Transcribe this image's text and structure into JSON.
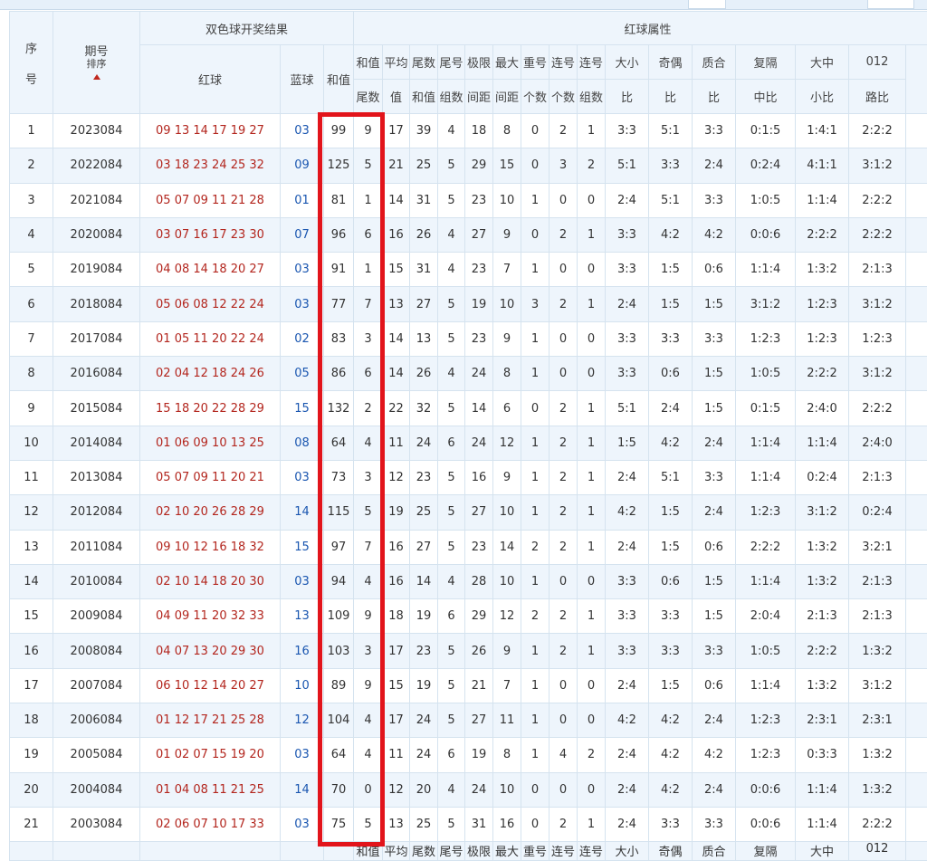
{
  "headers": {
    "seq": "序号",
    "seq_line1": "序",
    "seq_line2": "号",
    "issue": "期号",
    "sort_label": "排序",
    "group_result": "双色球开奖结果",
    "group_attr": "红球属性",
    "red": "红球",
    "blue": "蓝球",
    "sum": "和值",
    "sum_tail_1": "和值",
    "sum_tail_2": "尾数",
    "avg_1": "平均",
    "avg_2": "值",
    "tail_sum_1": "尾数",
    "tail_sum_2": "和值",
    "tail_groups_1": "尾号",
    "tail_groups_2": "组数",
    "range_1": "极限",
    "range_2": "间距",
    "max_gap_1": "最大",
    "max_gap_2": "间距",
    "repeat_1": "重号",
    "repeat_2": "个数",
    "consec_count_1": "连号",
    "consec_count_2": "个数",
    "consec_groups_1": "连号",
    "consec_groups_2": "组数",
    "big_small_1": "大小",
    "big_small_2": "比",
    "odd_even_1": "奇偶",
    "odd_even_2": "比",
    "prime_1": "质合",
    "prime_2": "比",
    "repeat_gap_1": "复隔",
    "repeat_gap_2": "中比",
    "zone_1": "大中",
    "zone_2": "小比",
    "road_1": "012",
    "road_2": "路比"
  },
  "footer": [
    "",
    "",
    "",
    "",
    "",
    "和值",
    "平均",
    "尾数",
    "尾号",
    "极限",
    "最大",
    "重号",
    "连号",
    "连号",
    "大小",
    "奇偶",
    "质合",
    "复隔",
    "大中",
    "012"
  ],
  "rows": [
    {
      "seq": "1",
      "issue": "2023084",
      "red": "09 13 14 17 19 27",
      "blue": "03",
      "sum": "99",
      "sum_tail": "9",
      "avg": "17",
      "tail_sum": "39",
      "tail_groups": "4",
      "range": "18",
      "max_gap": "8",
      "repeat": "0",
      "consec_count": "2",
      "consec_groups": "1",
      "big_small": "3:3",
      "odd_even": "5:1",
      "prime": "3:3",
      "repeat_gap": "0:1:5",
      "zone": "1:4:1",
      "road": "2:2:2"
    },
    {
      "seq": "2",
      "issue": "2022084",
      "red": "03 18 23 24 25 32",
      "blue": "09",
      "sum": "125",
      "sum_tail": "5",
      "avg": "21",
      "tail_sum": "25",
      "tail_groups": "5",
      "range": "29",
      "max_gap": "15",
      "repeat": "0",
      "consec_count": "3",
      "consec_groups": "2",
      "big_small": "5:1",
      "odd_even": "3:3",
      "prime": "2:4",
      "repeat_gap": "0:2:4",
      "zone": "4:1:1",
      "road": "3:1:2"
    },
    {
      "seq": "3",
      "issue": "2021084",
      "red": "05 07 09 11 21 28",
      "blue": "01",
      "sum": "81",
      "sum_tail": "1",
      "avg": "14",
      "tail_sum": "31",
      "tail_groups": "5",
      "range": "23",
      "max_gap": "10",
      "repeat": "1",
      "consec_count": "0",
      "consec_groups": "0",
      "big_small": "2:4",
      "odd_even": "5:1",
      "prime": "3:3",
      "repeat_gap": "1:0:5",
      "zone": "1:1:4",
      "road": "2:2:2"
    },
    {
      "seq": "4",
      "issue": "2020084",
      "red": "03 07 16 17 23 30",
      "blue": "07",
      "sum": "96",
      "sum_tail": "6",
      "avg": "16",
      "tail_sum": "26",
      "tail_groups": "4",
      "range": "27",
      "max_gap": "9",
      "repeat": "0",
      "consec_count": "2",
      "consec_groups": "1",
      "big_small": "3:3",
      "odd_even": "4:2",
      "prime": "4:2",
      "repeat_gap": "0:0:6",
      "zone": "2:2:2",
      "road": "2:2:2"
    },
    {
      "seq": "5",
      "issue": "2019084",
      "red": "04 08 14 18 20 27",
      "blue": "03",
      "sum": "91",
      "sum_tail": "1",
      "avg": "15",
      "tail_sum": "31",
      "tail_groups": "4",
      "range": "23",
      "max_gap": "7",
      "repeat": "1",
      "consec_count": "0",
      "consec_groups": "0",
      "big_small": "3:3",
      "odd_even": "1:5",
      "prime": "0:6",
      "repeat_gap": "1:1:4",
      "zone": "1:3:2",
      "road": "2:1:3"
    },
    {
      "seq": "6",
      "issue": "2018084",
      "red": "05 06 08 12 22 24",
      "blue": "03",
      "sum": "77",
      "sum_tail": "7",
      "avg": "13",
      "tail_sum": "27",
      "tail_groups": "5",
      "range": "19",
      "max_gap": "10",
      "repeat": "3",
      "consec_count": "2",
      "consec_groups": "1",
      "big_small": "2:4",
      "odd_even": "1:5",
      "prime": "1:5",
      "repeat_gap": "3:1:2",
      "zone": "1:2:3",
      "road": "3:1:2"
    },
    {
      "seq": "7",
      "issue": "2017084",
      "red": "01 05 11 20 22 24",
      "blue": "02",
      "sum": "83",
      "sum_tail": "3",
      "avg": "14",
      "tail_sum": "13",
      "tail_groups": "5",
      "range": "23",
      "max_gap": "9",
      "repeat": "1",
      "consec_count": "0",
      "consec_groups": "0",
      "big_small": "3:3",
      "odd_even": "3:3",
      "prime": "3:3",
      "repeat_gap": "1:2:3",
      "zone": "1:2:3",
      "road": "1:2:3"
    },
    {
      "seq": "8",
      "issue": "2016084",
      "red": "02 04 12 18 24 26",
      "blue": "05",
      "sum": "86",
      "sum_tail": "6",
      "avg": "14",
      "tail_sum": "26",
      "tail_groups": "4",
      "range": "24",
      "max_gap": "8",
      "repeat": "1",
      "consec_count": "0",
      "consec_groups": "0",
      "big_small": "3:3",
      "odd_even": "0:6",
      "prime": "1:5",
      "repeat_gap": "1:0:5",
      "zone": "2:2:2",
      "road": "3:1:2"
    },
    {
      "seq": "9",
      "issue": "2015084",
      "red": "15 18 20 22 28 29",
      "blue": "15",
      "sum": "132",
      "sum_tail": "2",
      "avg": "22",
      "tail_sum": "32",
      "tail_groups": "5",
      "range": "14",
      "max_gap": "6",
      "repeat": "0",
      "consec_count": "2",
      "consec_groups": "1",
      "big_small": "5:1",
      "odd_even": "2:4",
      "prime": "1:5",
      "repeat_gap": "0:1:5",
      "zone": "2:4:0",
      "road": "2:2:2"
    },
    {
      "seq": "10",
      "issue": "2014084",
      "red": "01 06 09 10 13 25",
      "blue": "08",
      "sum": "64",
      "sum_tail": "4",
      "avg": "11",
      "tail_sum": "24",
      "tail_groups": "6",
      "range": "24",
      "max_gap": "12",
      "repeat": "1",
      "consec_count": "2",
      "consec_groups": "1",
      "big_small": "1:5",
      "odd_even": "4:2",
      "prime": "2:4",
      "repeat_gap": "1:1:4",
      "zone": "1:1:4",
      "road": "2:4:0"
    },
    {
      "seq": "11",
      "issue": "2013084",
      "red": "05 07 09 11 20 21",
      "blue": "03",
      "sum": "73",
      "sum_tail": "3",
      "avg": "12",
      "tail_sum": "23",
      "tail_groups": "5",
      "range": "16",
      "max_gap": "9",
      "repeat": "1",
      "consec_count": "2",
      "consec_groups": "1",
      "big_small": "2:4",
      "odd_even": "5:1",
      "prime": "3:3",
      "repeat_gap": "1:1:4",
      "zone": "0:2:4",
      "road": "2:1:3"
    },
    {
      "seq": "12",
      "issue": "2012084",
      "red": "02 10 20 26 28 29",
      "blue": "14",
      "sum": "115",
      "sum_tail": "5",
      "avg": "19",
      "tail_sum": "25",
      "tail_groups": "5",
      "range": "27",
      "max_gap": "10",
      "repeat": "1",
      "consec_count": "2",
      "consec_groups": "1",
      "big_small": "4:2",
      "odd_even": "1:5",
      "prime": "2:4",
      "repeat_gap": "1:2:3",
      "zone": "3:1:2",
      "road": "0:2:4"
    },
    {
      "seq": "13",
      "issue": "2011084",
      "red": "09 10 12 16 18 32",
      "blue": "15",
      "sum": "97",
      "sum_tail": "7",
      "avg": "16",
      "tail_sum": "27",
      "tail_groups": "5",
      "range": "23",
      "max_gap": "14",
      "repeat": "2",
      "consec_count": "2",
      "consec_groups": "1",
      "big_small": "2:4",
      "odd_even": "1:5",
      "prime": "0:6",
      "repeat_gap": "2:2:2",
      "zone": "1:3:2",
      "road": "3:2:1"
    },
    {
      "seq": "14",
      "issue": "2010084",
      "red": "02 10 14 18 20 30",
      "blue": "03",
      "sum": "94",
      "sum_tail": "4",
      "avg": "16",
      "tail_sum": "14",
      "tail_groups": "4",
      "range": "28",
      "max_gap": "10",
      "repeat": "1",
      "consec_count": "0",
      "consec_groups": "0",
      "big_small": "3:3",
      "odd_even": "0:6",
      "prime": "1:5",
      "repeat_gap": "1:1:4",
      "zone": "1:3:2",
      "road": "2:1:3"
    },
    {
      "seq": "15",
      "issue": "2009084",
      "red": "04 09 11 20 32 33",
      "blue": "13",
      "sum": "109",
      "sum_tail": "9",
      "avg": "18",
      "tail_sum": "19",
      "tail_groups": "6",
      "range": "29",
      "max_gap": "12",
      "repeat": "2",
      "consec_count": "2",
      "consec_groups": "1",
      "big_small": "3:3",
      "odd_even": "3:3",
      "prime": "1:5",
      "repeat_gap": "2:0:4",
      "zone": "2:1:3",
      "road": "2:1:3"
    },
    {
      "seq": "16",
      "issue": "2008084",
      "red": "04 07 13 20 29 30",
      "blue": "16",
      "sum": "103",
      "sum_tail": "3",
      "avg": "17",
      "tail_sum": "23",
      "tail_groups": "5",
      "range": "26",
      "max_gap": "9",
      "repeat": "1",
      "consec_count": "2",
      "consec_groups": "1",
      "big_small": "3:3",
      "odd_even": "3:3",
      "prime": "3:3",
      "repeat_gap": "1:0:5",
      "zone": "2:2:2",
      "road": "1:3:2"
    },
    {
      "seq": "17",
      "issue": "2007084",
      "red": "06 10 12 14 20 27",
      "blue": "10",
      "sum": "89",
      "sum_tail": "9",
      "avg": "15",
      "tail_sum": "19",
      "tail_groups": "5",
      "range": "21",
      "max_gap": "7",
      "repeat": "1",
      "consec_count": "0",
      "consec_groups": "0",
      "big_small": "2:4",
      "odd_even": "1:5",
      "prime": "0:6",
      "repeat_gap": "1:1:4",
      "zone": "1:3:2",
      "road": "3:1:2"
    },
    {
      "seq": "18",
      "issue": "2006084",
      "red": "01 12 17 21 25 28",
      "blue": "12",
      "sum": "104",
      "sum_tail": "4",
      "avg": "17",
      "tail_sum": "24",
      "tail_groups": "5",
      "range": "27",
      "max_gap": "11",
      "repeat": "1",
      "consec_count": "0",
      "consec_groups": "0",
      "big_small": "4:2",
      "odd_even": "4:2",
      "prime": "2:4",
      "repeat_gap": "1:2:3",
      "zone": "2:3:1",
      "road": "2:3:1"
    },
    {
      "seq": "19",
      "issue": "2005084",
      "red": "01 02 07 15 19 20",
      "blue": "03",
      "sum": "64",
      "sum_tail": "4",
      "avg": "11",
      "tail_sum": "24",
      "tail_groups": "6",
      "range": "19",
      "max_gap": "8",
      "repeat": "1",
      "consec_count": "4",
      "consec_groups": "2",
      "big_small": "2:4",
      "odd_even": "4:2",
      "prime": "4:2",
      "repeat_gap": "1:2:3",
      "zone": "0:3:3",
      "road": "1:3:2"
    },
    {
      "seq": "20",
      "issue": "2004084",
      "red": "01 04 08 11 21 25",
      "blue": "14",
      "sum": "70",
      "sum_tail": "0",
      "avg": "12",
      "tail_sum": "20",
      "tail_groups": "4",
      "range": "24",
      "max_gap": "10",
      "repeat": "0",
      "consec_count": "0",
      "consec_groups": "0",
      "big_small": "2:4",
      "odd_even": "4:2",
      "prime": "2:4",
      "repeat_gap": "0:0:6",
      "zone": "1:1:4",
      "road": "1:3:2"
    },
    {
      "seq": "21",
      "issue": "2003084",
      "red": "02 06 07 10 17 33",
      "blue": "03",
      "sum": "75",
      "sum_tail": "5",
      "avg": "13",
      "tail_sum": "25",
      "tail_groups": "5",
      "range": "31",
      "max_gap": "16",
      "repeat": "0",
      "consec_count": "2",
      "consec_groups": "1",
      "big_small": "2:4",
      "odd_even": "3:3",
      "prime": "3:3",
      "repeat_gap": "0:0:6",
      "zone": "1:1:4",
      "road": "2:2:2"
    }
  ],
  "colors": {
    "red_ball": "#b3261e",
    "blue_ball": "#1a56b0",
    "highlight_box": "#e2141b",
    "header_bg": "#eef5fc"
  }
}
